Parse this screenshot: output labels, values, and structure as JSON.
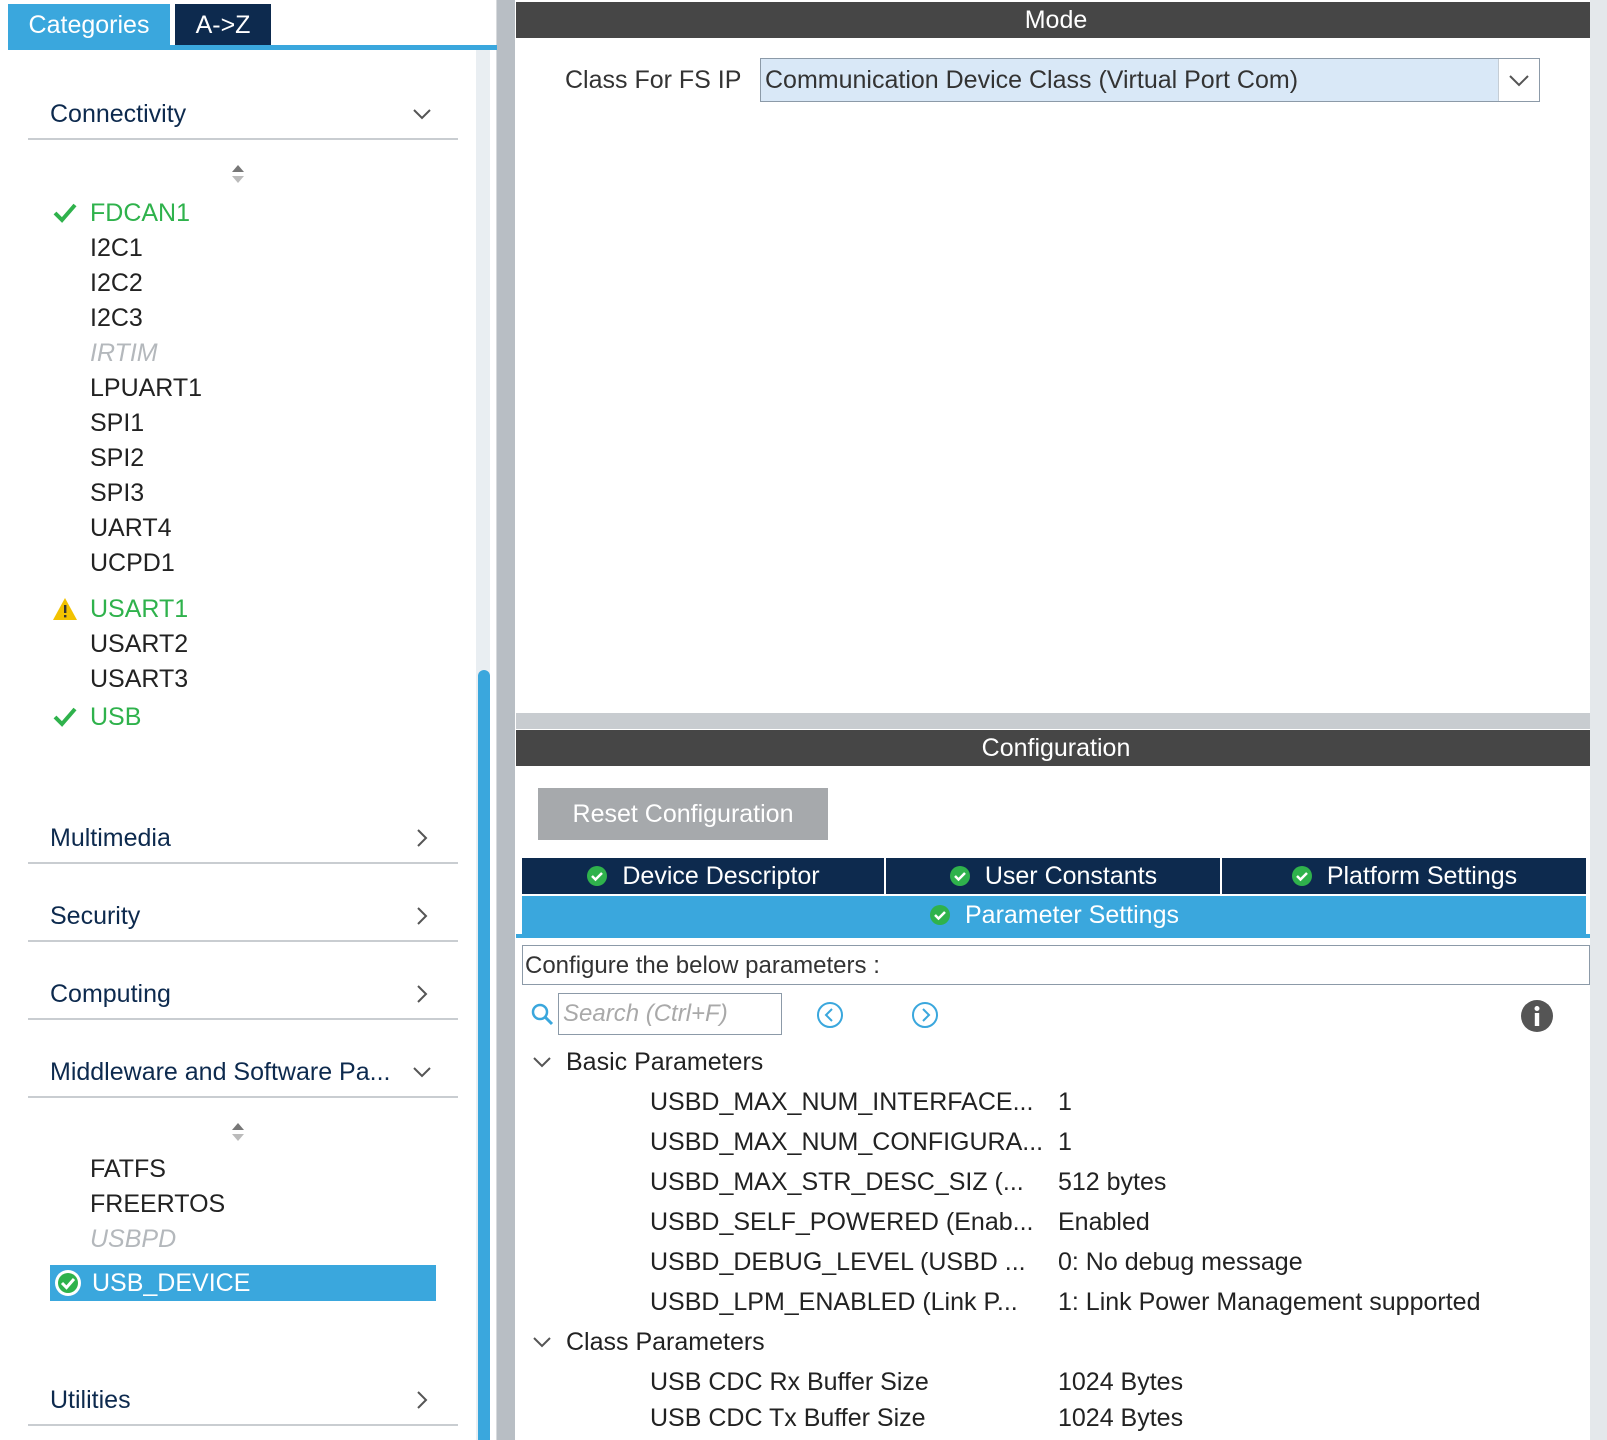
{
  "left_panel": {
    "tabs": {
      "categories": "Categories",
      "az": "A->Z"
    },
    "categories": [
      {
        "label": "Connectivity",
        "expanded": true
      },
      {
        "label": "Multimedia",
        "expanded": false
      },
      {
        "label": "Security",
        "expanded": false
      },
      {
        "label": "Computing",
        "expanded": false
      },
      {
        "label": "Middleware and Software Pa...",
        "expanded": true
      },
      {
        "label": "Utilities",
        "expanded": false
      }
    ],
    "connectivity_items": [
      {
        "label": "FDCAN1",
        "state": "ok"
      },
      {
        "label": "I2C1",
        "state": "normal"
      },
      {
        "label": "I2C2",
        "state": "normal"
      },
      {
        "label": "I2C3",
        "state": "normal"
      },
      {
        "label": "IRTIM",
        "state": "disabled"
      },
      {
        "label": "LPUART1",
        "state": "normal"
      },
      {
        "label": "SPI1",
        "state": "normal"
      },
      {
        "label": "SPI2",
        "state": "normal"
      },
      {
        "label": "SPI3",
        "state": "normal"
      },
      {
        "label": "UART4",
        "state": "normal"
      },
      {
        "label": "UCPD1",
        "state": "normal"
      },
      {
        "label": "USART1",
        "state": "warning"
      },
      {
        "label": "USART2",
        "state": "normal"
      },
      {
        "label": "USART3",
        "state": "normal"
      },
      {
        "label": "USB",
        "state": "ok"
      }
    ],
    "middleware_items": [
      {
        "label": "FATFS",
        "state": "normal"
      },
      {
        "label": "FREERTOS",
        "state": "normal"
      },
      {
        "label": "USBPD",
        "state": "disabled"
      },
      {
        "label": "USB_DEVICE",
        "state": "selected"
      }
    ]
  },
  "mode": {
    "title": "Mode",
    "class_label": "Class For FS IP",
    "class_value": "Communication Device Class (Virtual Port Com)"
  },
  "configuration": {
    "title": "Configuration",
    "reset_label": "Reset Configuration",
    "tabs": {
      "device_descriptor": "Device Descriptor",
      "user_constants": "User Constants",
      "platform_settings": "Platform Settings",
      "parameter_settings": "Parameter Settings"
    },
    "hint": "Configure the below parameters :",
    "search_placeholder": "Search (Ctrl+F)",
    "groups": [
      {
        "label": "Basic Parameters",
        "params": [
          {
            "name": "USBD_MAX_NUM_INTERFACE...",
            "value": "1"
          },
          {
            "name": "USBD_MAX_NUM_CONFIGURA...",
            "value": "1"
          },
          {
            "name": "USBD_MAX_STR_DESC_SIZ (...",
            "value": "512 bytes"
          },
          {
            "name": "USBD_SELF_POWERED (Enab...",
            "value": "Enabled"
          },
          {
            "name": "USBD_DEBUG_LEVEL (USBD ...",
            "value": "0: No debug message"
          },
          {
            "name": "USBD_LPM_ENABLED (Link P...",
            "value": "1: Link Power Management supported"
          }
        ]
      },
      {
        "label": "Class Parameters",
        "params": [
          {
            "name": "USB CDC Rx Buffer Size",
            "value": "1024 Bytes"
          },
          {
            "name": "USB CDC Tx Buffer Size",
            "value": "1024 Bytes"
          }
        ]
      }
    ]
  },
  "colors": {
    "accent": "#3aa7dd",
    "navy": "#0d2a4e",
    "ok_green": "#2fb24c",
    "warning_yellow": "#f2c200",
    "header_gray": "#464646"
  }
}
